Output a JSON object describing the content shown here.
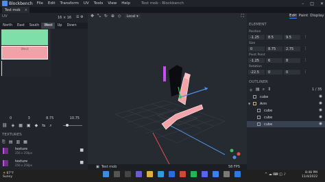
{
  "app": {
    "name": "Blockbench",
    "window_title": "Test mob - Blockbench",
    "menus": [
      "File",
      "Edit",
      "Transform",
      "UV",
      "Tools",
      "View",
      "Help"
    ]
  },
  "tab": {
    "label": "Test mob",
    "close": "×"
  },
  "uv": {
    "title": "UV",
    "size": "16 × 16",
    "faces": [
      "North",
      "East",
      "South",
      "West",
      "Up",
      "Down"
    ],
    "selected_face": "West",
    "face_label": "West",
    "coords": [
      "0",
      "3",
      "8.75",
      "10.75"
    ]
  },
  "textures": {
    "title": "TEXTURES",
    "items": [
      {
        "name": "texture",
        "res": "256 x 256px"
      },
      {
        "name": "texture",
        "res": "256 x 256px"
      }
    ]
  },
  "viewport": {
    "mode": "Local",
    "status_name": "Test mob",
    "fps": "58 FPS"
  },
  "modes": [
    "Edit",
    "Paint",
    "Display"
  ],
  "element": {
    "title": "ELEMENT",
    "position_label": "Position",
    "position": [
      "-1.25",
      "8.5",
      "9.5"
    ],
    "size_label": "Size",
    "size": [
      "0",
      "8.75",
      "2.75"
    ],
    "pivot_label": "Pivot Point",
    "pivot": [
      "-1.25",
      "6",
      "8"
    ],
    "rotation_label": "Rotation",
    "rotation": [
      "-22.5",
      "0",
      "0"
    ]
  },
  "outliner": {
    "title": "OUTLINER",
    "count": "1 / 35",
    "items": [
      {
        "label": "cube",
        "type": "cube",
        "indent": 0
      },
      {
        "label": "Arm",
        "type": "group",
        "indent": 0
      },
      {
        "label": "cube",
        "type": "cube",
        "indent": 1
      },
      {
        "label": "cube",
        "type": "cube",
        "indent": 1
      },
      {
        "label": "cube",
        "type": "cube",
        "indent": 1,
        "selected": true
      }
    ]
  },
  "taskbar": {
    "temp": "67°F",
    "weather": "Sunny",
    "time": "8:48 PM",
    "date": "11/4/2022"
  },
  "colors": {
    "accent": "#4f8fe6",
    "uv_green": "#7ee0a8",
    "uv_pink": "#f0a2a8",
    "cube_pink": "#f4a3a8"
  }
}
